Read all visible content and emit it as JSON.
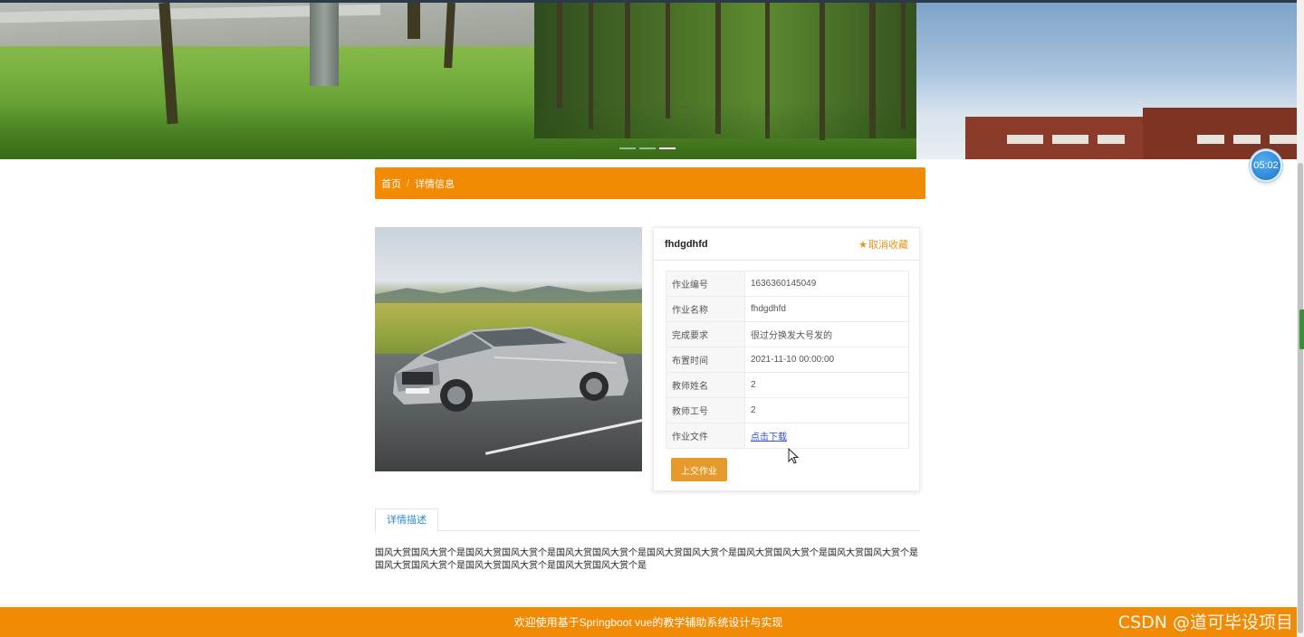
{
  "timer": {
    "text": "05:02"
  },
  "breadcrumb": {
    "home": "首页",
    "separator": "/",
    "current": "详情信息"
  },
  "detail": {
    "title": "fhdgdhfd",
    "favorite_label": "取消收藏",
    "rows": [
      {
        "label": "作业编号",
        "value": "1636360145049"
      },
      {
        "label": "作业名称",
        "value": "fhdgdhfd"
      },
      {
        "label": "完成要求",
        "value": "很过分换发大号发的"
      },
      {
        "label": "布置时间",
        "value": "2021-11-10 00:00:00"
      },
      {
        "label": "教师姓名",
        "value": "2"
      },
      {
        "label": "教师工号",
        "value": "2"
      }
    ],
    "file_label": "作业文件",
    "file_link": "点击下载",
    "submit_label": "上交作业"
  },
  "tabs": {
    "description": "详情描述"
  },
  "description": "国风大赏国风大赏个是国风大赏国风大赏个是国风大赏国风大赏个是国风大赏国风大赏个是国风大赏国风大赏个是国风大赏国风大赏个是国风大赏国风大赏个是国风大赏国风大赏个是国风大赏国风大赏个是",
  "footer": {
    "text": "欢迎使用基于Springboot vue的教学辅助系统设计与实现"
  },
  "watermark": "CSDN @道可毕设项目",
  "carousel": {
    "slide_count": 3,
    "active_index": 2
  },
  "colors": {
    "accent": "#f18b05",
    "button": "#e59a2b",
    "tab_active": "#2f8bd2",
    "timer": "#2a86d8"
  },
  "icons": {
    "favorite": "star-icon",
    "cursor": "mouse-pointer-icon"
  }
}
